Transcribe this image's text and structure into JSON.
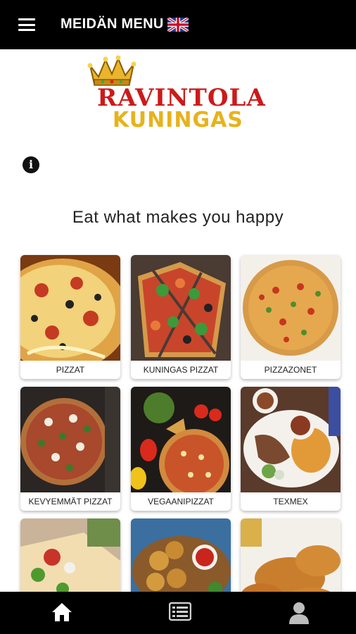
{
  "header": {
    "title": "MEIDÄN MENU"
  },
  "logo": {
    "line1": "RAVINTOLA",
    "line2": "KUNINGAS"
  },
  "tagline": "Eat what makes you happy",
  "categories": [
    {
      "label": "PIZZAT"
    },
    {
      "label": "KUNINGAS PIZZAT"
    },
    {
      "label": "PIZZAZONET"
    },
    {
      "label": "KEVYEMMÄT PIZZAT"
    },
    {
      "label": "VEGAANIPIZZAT"
    },
    {
      "label": "TEXMEX"
    },
    {
      "label": ""
    },
    {
      "label": ""
    },
    {
      "label": ""
    }
  ],
  "icons": [
    "menu-icon",
    "uk-flag-icon",
    "crown-icon",
    "info-icon",
    "home-icon",
    "menu-list-icon",
    "user-icon"
  ],
  "colors": {
    "bar": "#000000",
    "logo_red": "#cc1a1a",
    "logo_gold": "#e8b21c"
  }
}
